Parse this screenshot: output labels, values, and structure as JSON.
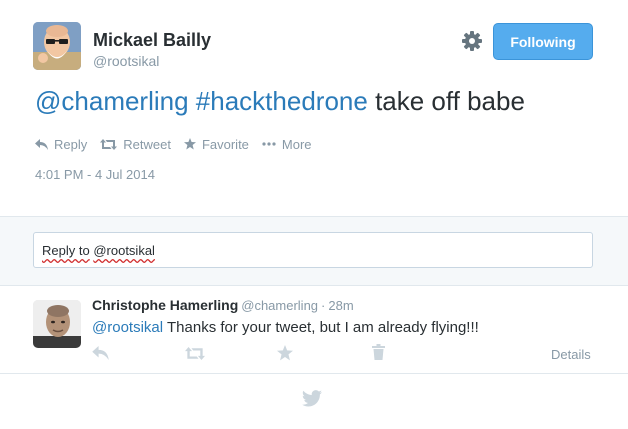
{
  "author": {
    "name": "Mickael Bailly",
    "handle": "@rootsikal"
  },
  "follow_button": {
    "label": "Following"
  },
  "tweet": {
    "mention": "@chamerling",
    "hashtag": "#hackthedrone",
    "text": "take off babe",
    "timestamp": "4:01 PM - 4 Jul 2014"
  },
  "actions": [
    {
      "label": "Reply",
      "icon": "reply-icon"
    },
    {
      "label": "Retweet",
      "icon": "retweet-icon"
    },
    {
      "label": "Favorite",
      "icon": "star-icon"
    },
    {
      "label": "More",
      "icon": "more-icon"
    }
  ],
  "reply_box": {
    "prefix": "Reply to",
    "handle": "@rootsikal"
  },
  "reply": {
    "name": "Christophe Hamerling",
    "handle": "@chamerling",
    "separator": "·",
    "age": "28m",
    "mention": "@rootsikal",
    "text": "Thanks for your tweet, but I am already flying!!!",
    "details_label": "Details"
  },
  "colors": {
    "accent": "#55acee",
    "link": "#2b7bb9",
    "muted": "#8899a6",
    "band": "#f5f8fa"
  }
}
